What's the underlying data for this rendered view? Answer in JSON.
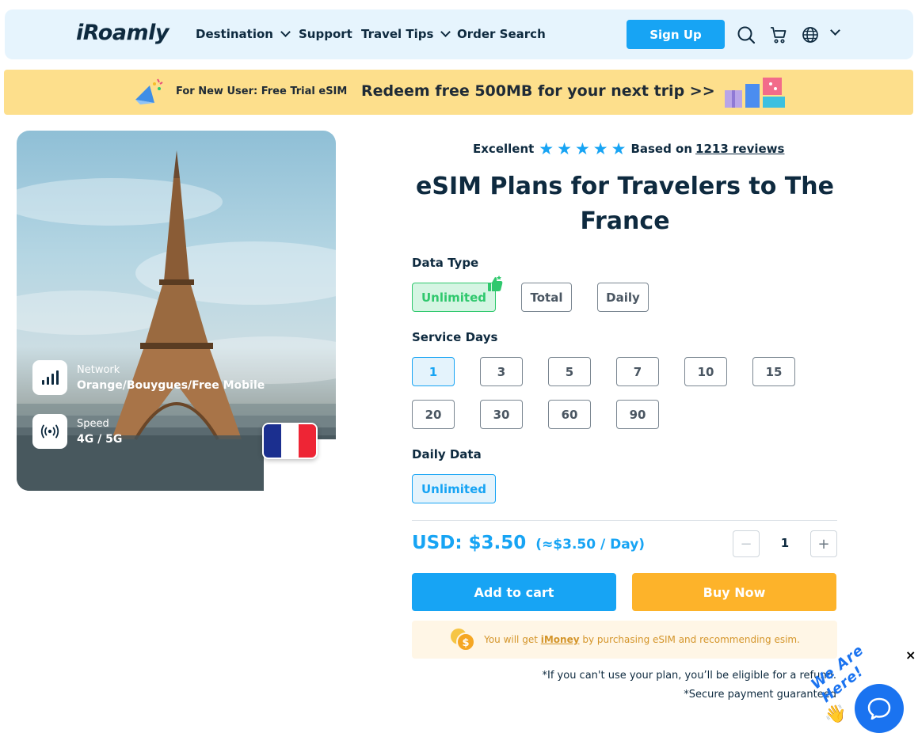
{
  "header": {
    "logo": "iRoamly",
    "nav": [
      "Destination",
      "Support",
      "Travel Tips",
      "Order Search"
    ],
    "signup_label": "Sign Up",
    "icons": [
      "search-icon",
      "cart-icon",
      "globe-icon",
      "chevron-down-icon"
    ]
  },
  "promo": {
    "small_text": "For New User: Free Trial eSIM",
    "big_text": "Redeem free 500MB for your next trip >>"
  },
  "hero": {
    "network_label": "Network",
    "network_value": "Orange/Bouygues/Free Mobile",
    "speed_label": "Speed",
    "speed_value": "4G / 5G",
    "flag_colors": [
      "#1b2f8f",
      "#ffffff",
      "#ee2535"
    ]
  },
  "rating": {
    "label": "Excellent",
    "stars": 5,
    "based_on": "Based on",
    "reviews_link": "1213 reviews"
  },
  "title_line1": "eSIM Plans for Travelers to The",
  "title_line2": "France",
  "data_type": {
    "label": "Data Type",
    "options": [
      "Unlimited",
      "Total",
      "Daily"
    ],
    "selected": "Unlimited"
  },
  "service_days": {
    "label": "Service Days",
    "options": [
      "1",
      "3",
      "5",
      "7",
      "10",
      "15",
      "20",
      "30",
      "60",
      "90"
    ],
    "selected": "1"
  },
  "daily_data": {
    "label": "Daily Data",
    "options": [
      "Unlimited"
    ],
    "selected": "Unlimited"
  },
  "price": {
    "total": "USD: $3.50",
    "per_day": "(≈$3.50 / Day)"
  },
  "quantity": {
    "minus": "−",
    "value": "1",
    "plus": "+"
  },
  "actions": {
    "add_to_cart": "Add to cart",
    "buy_now": "Buy Now"
  },
  "imoney": {
    "prefix": "You will get",
    "link": "iMoney",
    "suffix": "by purchasing eSIM and recommending esim."
  },
  "notes": {
    "refund": "*If you can't use your plan, you’ll be eligible for a refund.",
    "secure": "*Secure payment guaranteed"
  },
  "chat": {
    "tag": "We Are Here!",
    "close": "×"
  },
  "colors": {
    "primary": "#17a4f4",
    "buy": "#fdb32a",
    "green": "#2fc86d",
    "promo_bg": "#fddf8c",
    "header_bg": "#e6f4fd"
  }
}
